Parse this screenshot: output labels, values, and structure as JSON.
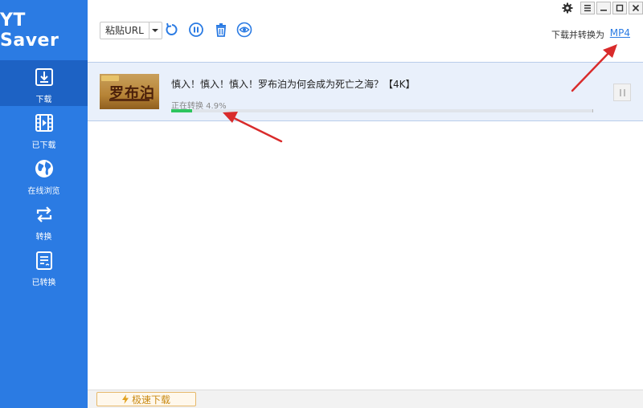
{
  "app": {
    "title": "YT Saver"
  },
  "sidebar": {
    "items": [
      {
        "label": "下载",
        "icon": "download-icon",
        "active": true
      },
      {
        "label": "已下载",
        "icon": "film-icon",
        "active": false
      },
      {
        "label": "在线浏览",
        "icon": "globe-icon",
        "active": false
      },
      {
        "label": "转换",
        "icon": "convert-icon",
        "active": false
      },
      {
        "label": "已转换",
        "icon": "converted-doc-icon",
        "active": false
      }
    ]
  },
  "toolbar": {
    "paste_label": "粘贴URL",
    "buttons": [
      {
        "icon": "refresh-icon"
      },
      {
        "icon": "pause-all-icon"
      },
      {
        "icon": "trash-icon"
      },
      {
        "icon": "eye-icon"
      }
    ],
    "convert_label": "下载并转换为",
    "convert_format": "MP4"
  },
  "window_controls": [
    "gear-icon",
    "menu-icon",
    "minimize-icon",
    "maximize-icon",
    "close-icon"
  ],
  "downloads": [
    {
      "title": "慎入！慎入！慎入！罗布泊为何会成为死亡之海？【4K】",
      "thumbnail_text": "罗布泊",
      "status": "正在转换 4.9%",
      "progress": 0.049
    }
  ],
  "bottom": {
    "fast_download_label": "极速下载"
  },
  "colors": {
    "sidebar": "#2b7be3",
    "sidebar_active": "#1d62c4",
    "accent": "#2b7be3",
    "progress": "#2ec55e",
    "annotation_arrow": "#d92b2b"
  }
}
